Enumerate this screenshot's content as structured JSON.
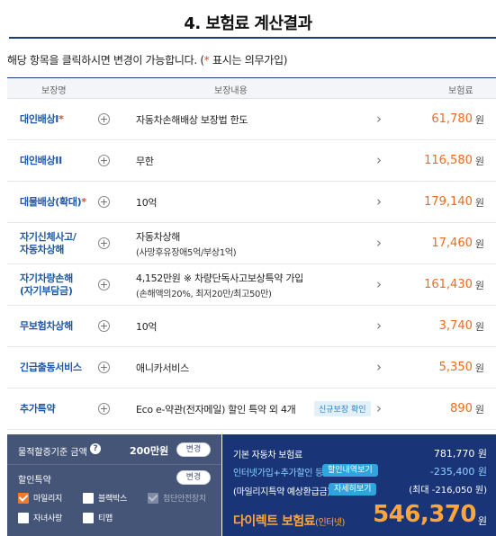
{
  "title": "4. 보험료 계산결과",
  "notice": {
    "text": "해당 항목을 클릭하시면 변경이 가능합니다. (",
    "star": "*",
    "rest": " 표시는 의무가입)"
  },
  "table": {
    "headers": {
      "name": "보장명",
      "content": "보장내용",
      "premium": "보험료"
    },
    "rows": [
      {
        "name": "대인배상I",
        "required": "*",
        "content": "자동차손해배상 보장법 한도",
        "sub": "",
        "tag": "",
        "premium": "61,780",
        "unit": "원"
      },
      {
        "name": "대인배상II",
        "required": "",
        "content": "무한",
        "sub": "",
        "tag": "",
        "premium": "116,580",
        "unit": "원"
      },
      {
        "name": "대물배상(확대)",
        "required": "*",
        "content": "10억",
        "sub": "",
        "tag": "",
        "premium": "179,140",
        "unit": "원"
      },
      {
        "name": "자기신체사고/\n자동차상해",
        "required": "",
        "content": "자동차상해",
        "sub": "(사망후유장애5억/부상1억)",
        "tag": "",
        "premium": "17,460",
        "unit": "원"
      },
      {
        "name": "자기차량손해\n(자기부담금)",
        "required": "",
        "content": "4,152만원 ※ 차량단독사고보상특약 가입",
        "sub": "(손해액의20%, 최저20만/최고50만)",
        "tag": "",
        "premium": "161,430",
        "unit": "원"
      },
      {
        "name": "무보험차상해",
        "required": "",
        "content": "10억",
        "sub": "",
        "tag": "",
        "premium": "3,740",
        "unit": "원"
      },
      {
        "name": "긴급출동서비스",
        "required": "",
        "content": "애니카서비스",
        "sub": "",
        "tag": "",
        "premium": "5,350",
        "unit": "원"
      },
      {
        "name": "추가특약",
        "required": "",
        "content": "Eco e-약관(전자메일) 할인 특약 외 4개",
        "sub": "",
        "tag": "신규보장 확인",
        "premium": "890",
        "unit": "원"
      }
    ]
  },
  "left_panel": {
    "property_label": "물적할증기준 금액",
    "property_value": "200만원",
    "change_label": "변경",
    "discount_label": "할인특약",
    "discount_change_label": "변경",
    "options": [
      {
        "label": "마일리지",
        "state": "checked"
      },
      {
        "label": "블랙박스",
        "state": "unchecked"
      },
      {
        "label": "첨단안전장치",
        "state": "disabled"
      },
      {
        "label": "자녀사랑",
        "state": "unchecked"
      },
      {
        "label": "티맵",
        "state": "unchecked"
      }
    ]
  },
  "right_panel": {
    "base_label": "기본 자동차 보험료",
    "base_value": "781,770 원",
    "discount_label": "인터넷가입+추가할인 등",
    "discount_button": "할인내역보기",
    "discount_value": "-235,400 원",
    "mileage_label": "(마일리지특약 예상환급금)",
    "mileage_button": "자세히보기",
    "mileage_value": "(최대 -216,050 원)",
    "direct_label": "다이렉트 보험료",
    "direct_sub": "(인터넷)",
    "direct_amount": "546,370",
    "direct_unit": "원"
  },
  "colors": {
    "accent": "#1e57a8",
    "premium": "#f06b1f",
    "panel_dark": "#1a3577",
    "panel_gray": "#455577",
    "highlight": "#ffa53a"
  }
}
